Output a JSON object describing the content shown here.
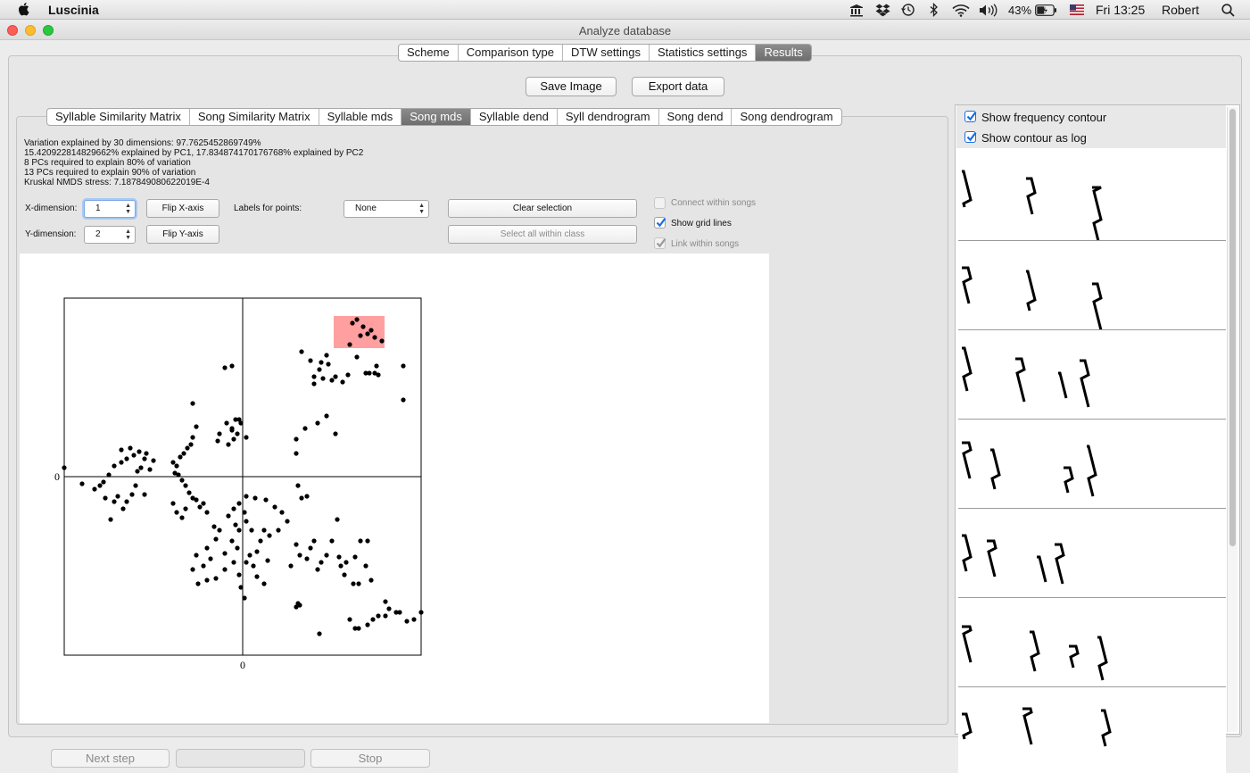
{
  "menubar": {
    "app_name": "Luscinia",
    "battery": "43%",
    "clock": "Fri 13:25",
    "user": "Robert",
    "icons": [
      "apple-icon",
      "museum-icon",
      "dropbox-icon",
      "time-machine-icon",
      "bluetooth-icon",
      "wifi-icon",
      "volume-icon",
      "battery-icon",
      "flag-icon",
      "search-icon"
    ]
  },
  "window": {
    "title": "Analyze database"
  },
  "top_tabs": [
    {
      "label": "Scheme",
      "selected": false
    },
    {
      "label": "Comparison type",
      "selected": false
    },
    {
      "label": "DTW settings",
      "selected": false
    },
    {
      "label": "Statistics settings",
      "selected": false
    },
    {
      "label": "Results",
      "selected": true
    }
  ],
  "actions": {
    "save_image": "Save Image",
    "export_data": "Export data"
  },
  "result_tabs": [
    {
      "label": "Syllable Similarity Matrix",
      "selected": false
    },
    {
      "label": "Song Similarity Matrix",
      "selected": false
    },
    {
      "label": "Syllable mds",
      "selected": false
    },
    {
      "label": "Song mds",
      "selected": true
    },
    {
      "label": "Syllable dend",
      "selected": false
    },
    {
      "label": "Syll dendrogram",
      "selected": false
    },
    {
      "label": "Song dend",
      "selected": false
    },
    {
      "label": "Song dendrogram",
      "selected": false
    }
  ],
  "stats": [
    "Variation explained by 30 dimensions: 97.7625452869749%",
    "15.420922814829662% explained by PC1, 17.834874170176768% explained by PC2",
    "8 PCs required to explain 80% of variation",
    "13 PCs required to explain 90% of variation",
    "Kruskal NMDS stress: 7.187849080622019E-4"
  ],
  "controls": {
    "x_dim_label": "X-dimension:",
    "x_dim_value": "1",
    "y_dim_label": "Y-dimension:",
    "y_dim_value": "2",
    "flip_x": "Flip X-axis",
    "flip_y": "Flip Y-axis",
    "labels_for_points": "Labels for points:",
    "labels_select": "None",
    "clear_selection": "Clear selection",
    "select_all_within_class": "Select all within class",
    "connect_within_songs": "Connect within songs",
    "connect_within_songs_checked": false,
    "show_grid_lines": "Show grid lines",
    "show_grid_lines_checked": true,
    "link_within_songs": "Link within songs",
    "link_within_songs_checked": true
  },
  "right_panel": {
    "show_frequency_contour": "Show frequency contour",
    "show_frequency_contour_checked": true,
    "show_contour_as_log": "Show contour as log",
    "show_contour_as_log_checked": true,
    "spectrogram_count": 7
  },
  "bottom": {
    "next_step": "Next step",
    "stop": "Stop"
  },
  "colors": {
    "selection": "#ff9f9f",
    "selected_tab": "#7a7a7a",
    "checkbox": "#1d6fe0"
  },
  "chart_data": {
    "type": "scatter",
    "title": "",
    "xlabel": "",
    "ylabel": "",
    "xlim": [
      -1,
      1
    ],
    "ylim": [
      -1,
      1
    ],
    "x_tick_labels": [
      {
        "value": 0,
        "label": "0"
      }
    ],
    "y_tick_labels": [
      {
        "value": 0,
        "label": "0"
      }
    ],
    "grid": true,
    "selection_region": {
      "x": [
        0.51,
        0.795
      ],
      "y": [
        0.72,
        0.9
      ]
    },
    "points": [
      [
        0.6,
        0.74
      ],
      [
        0.615,
        0.86
      ],
      [
        0.64,
        0.88
      ],
      [
        0.66,
        0.79
      ],
      [
        0.675,
        0.84
      ],
      [
        0.7,
        0.8
      ],
      [
        0.72,
        0.82
      ],
      [
        0.74,
        0.78
      ],
      [
        0.78,
        0.76
      ],
      [
        0.33,
        0.7
      ],
      [
        0.38,
        0.65
      ],
      [
        0.4,
        0.56
      ],
      [
        0.4,
        0.52
      ],
      [
        0.43,
        0.6
      ],
      [
        0.44,
        0.64
      ],
      [
        0.45,
        0.55
      ],
      [
        0.47,
        0.68
      ],
      [
        0.48,
        0.63
      ],
      [
        0.5,
        0.54
      ],
      [
        0.52,
        0.56
      ],
      [
        0.56,
        0.53
      ],
      [
        0.59,
        0.57
      ],
      [
        0.64,
        0.67
      ],
      [
        0.69,
        0.58
      ],
      [
        0.71,
        0.58
      ],
      [
        0.75,
        0.62
      ],
      [
        0.76,
        0.57
      ],
      [
        0.74,
        0.58
      ],
      [
        0.9,
        0.62
      ],
      [
        0.9,
        0.43
      ],
      [
        0.47,
        0.34
      ],
      [
        0.52,
        0.24
      ],
      [
        0.42,
        0.3
      ],
      [
        0.35,
        0.27
      ],
      [
        0.3,
        0.21
      ],
      [
        0.3,
        0.13
      ],
      [
        -0.06,
        0.62
      ],
      [
        -0.1,
        0.61
      ],
      [
        -0.28,
        0.41
      ],
      [
        -0.13,
        0.24
      ],
      [
        -0.14,
        0.2
      ],
      [
        -0.08,
        0.18
      ],
      [
        -0.06,
        0.27
      ],
      [
        -0.04,
        0.32
      ],
      [
        -0.02,
        0.32
      ],
      [
        -0.01,
        0.3
      ],
      [
        -0.06,
        0.26
      ],
      [
        -0.09,
        0.3
      ],
      [
        -0.05,
        0.21
      ],
      [
        -0.03,
        0.24
      ],
      [
        0.02,
        0.22
      ],
      [
        -0.26,
        0.28
      ],
      [
        -0.28,
        0.22
      ],
      [
        -0.29,
        0.18
      ],
      [
        -0.31,
        0.16
      ],
      [
        -0.33,
        0.13
      ],
      [
        -0.35,
        0.11
      ],
      [
        -0.37,
        0.06
      ],
      [
        -0.39,
        0.08
      ],
      [
        -0.38,
        0.02
      ],
      [
        -0.36,
        0.01
      ],
      [
        -0.34,
        -0.02
      ],
      [
        -0.32,
        -0.05
      ],
      [
        -0.3,
        -0.09
      ],
      [
        -0.28,
        -0.12
      ],
      [
        -0.26,
        -0.13
      ],
      [
        -0.24,
        -0.17
      ],
      [
        -0.22,
        -0.15
      ],
      [
        -0.2,
        -0.2
      ],
      [
        -0.32,
        -0.18
      ],
      [
        -0.34,
        -0.23
      ],
      [
        -0.37,
        -0.2
      ],
      [
        -0.39,
        -0.15
      ],
      [
        -0.5,
        0.09
      ],
      [
        -0.52,
        0.04
      ],
      [
        -0.55,
        0.1
      ],
      [
        -0.57,
        0.05
      ],
      [
        -0.59,
        0.03
      ],
      [
        -0.61,
        0.12
      ],
      [
        -0.65,
        0.1
      ],
      [
        -0.68,
        0.08
      ],
      [
        -0.72,
        0.06
      ],
      [
        -0.75,
        0.01
      ],
      [
        -0.78,
        -0.03
      ],
      [
        -0.8,
        -0.05
      ],
      [
        -0.83,
        -0.07
      ],
      [
        -0.68,
        0.15
      ],
      [
        -0.63,
        0.16
      ],
      [
        -0.58,
        0.14
      ],
      [
        -0.54,
        0.13
      ],
      [
        -0.55,
        -0.1
      ],
      [
        -0.6,
        -0.05
      ],
      [
        -0.62,
        -0.1
      ],
      [
        -0.65,
        -0.14
      ],
      [
        -0.67,
        -0.18
      ],
      [
        -0.7,
        -0.11
      ],
      [
        -0.72,
        -0.14
      ],
      [
        -0.74,
        -0.24
      ],
      [
        -0.77,
        -0.12
      ],
      [
        -1.0,
        0.05
      ],
      [
        -0.9,
        -0.04
      ],
      [
        0.02,
        -0.11
      ],
      [
        0.07,
        -0.12
      ],
      [
        0.13,
        -0.13
      ],
      [
        0.18,
        -0.17
      ],
      [
        0.22,
        -0.2
      ],
      [
        0.25,
        -0.25
      ],
      [
        0.31,
        -0.05
      ],
      [
        0.33,
        -0.12
      ],
      [
        0.36,
        -0.11
      ],
      [
        0.2,
        -0.3
      ],
      [
        0.15,
        -0.33
      ],
      [
        0.12,
        -0.3
      ],
      [
        0.1,
        -0.36
      ],
      [
        0.05,
        -0.3
      ],
      [
        0.02,
        -0.25
      ],
      [
        0.01,
        -0.2
      ],
      [
        -0.02,
        -0.15
      ],
      [
        -0.05,
        -0.18
      ],
      [
        -0.08,
        -0.22
      ],
      [
        -0.04,
        -0.27
      ],
      [
        -0.02,
        -0.3
      ],
      [
        -0.06,
        -0.36
      ],
      [
        -0.03,
        -0.4
      ],
      [
        -0.1,
        -0.43
      ],
      [
        -0.13,
        -0.3
      ],
      [
        -0.15,
        -0.35
      ],
      [
        -0.16,
        -0.28
      ],
      [
        -0.2,
        -0.4
      ],
      [
        -0.18,
        -0.46
      ],
      [
        -0.22,
        -0.5
      ],
      [
        -0.26,
        -0.44
      ],
      [
        -0.28,
        -0.52
      ],
      [
        -0.25,
        -0.6
      ],
      [
        -0.2,
        -0.58
      ],
      [
        -0.15,
        -0.57
      ],
      [
        -0.1,
        -0.52
      ],
      [
        -0.05,
        -0.48
      ],
      [
        -0.02,
        -0.55
      ],
      [
        -0.01,
        -0.62
      ],
      [
        0.01,
        -0.68
      ],
      [
        0.06,
        -0.5
      ],
      [
        0.08,
        -0.56
      ],
      [
        0.12,
        -0.6
      ],
      [
        0.14,
        -0.47
      ],
      [
        0.08,
        -0.42
      ],
      [
        0.04,
        -0.44
      ],
      [
        0.02,
        -0.48
      ],
      [
        0.27,
        -0.5
      ],
      [
        0.32,
        -0.44
      ],
      [
        0.3,
        -0.38
      ],
      [
        0.36,
        -0.46
      ],
      [
        0.38,
        -0.4
      ],
      [
        0.4,
        -0.36
      ],
      [
        0.42,
        -0.52
      ],
      [
        0.44,
        -0.48
      ],
      [
        0.47,
        -0.44
      ],
      [
        0.5,
        -0.36
      ],
      [
        0.53,
        -0.24
      ],
      [
        0.54,
        -0.45
      ],
      [
        0.55,
        -0.5
      ],
      [
        0.57,
        -0.55
      ],
      [
        0.58,
        -0.48
      ],
      [
        0.62,
        -0.6
      ],
      [
        0.63,
        -0.45
      ],
      [
        0.65,
        -0.6
      ],
      [
        0.66,
        -0.36
      ],
      [
        0.7,
        -0.36
      ],
      [
        0.69,
        -0.5
      ],
      [
        0.72,
        -0.58
      ],
      [
        0.32,
        -0.72
      ],
      [
        0.31,
        -0.71
      ],
      [
        0.3,
        -0.73
      ],
      [
        0.43,
        -0.88
      ],
      [
        0.6,
        -0.8
      ],
      [
        0.63,
        -0.85
      ],
      [
        0.65,
        -0.85
      ],
      [
        0.7,
        -0.83
      ],
      [
        0.73,
        -0.8
      ],
      [
        0.76,
        -0.78
      ],
      [
        0.8,
        -0.78
      ],
      [
        0.8,
        -0.7
      ],
      [
        0.82,
        -0.74
      ],
      [
        0.86,
        -0.76
      ],
      [
        0.88,
        -0.76
      ],
      [
        0.92,
        -0.81
      ],
      [
        0.96,
        -0.8
      ],
      [
        1.0,
        -0.76
      ]
    ]
  }
}
